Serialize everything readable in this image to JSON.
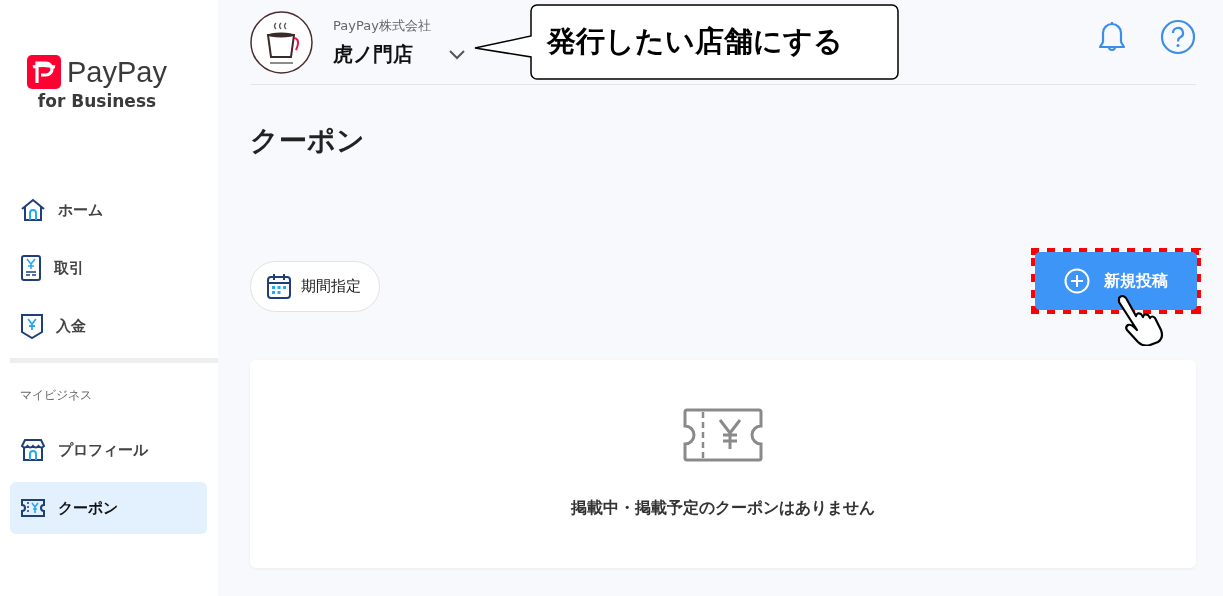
{
  "brand": {
    "name": "PayPay",
    "sub": "for Business"
  },
  "sidebar": {
    "items": [
      {
        "label": "ホーム",
        "kind": "home",
        "selected": false
      },
      {
        "label": "取引",
        "kind": "receipt",
        "selected": false
      },
      {
        "label": "入金",
        "kind": "deposit",
        "selected": false
      }
    ],
    "section": "マイビジネス",
    "section_items": [
      {
        "label": "プロフィール",
        "kind": "shop",
        "selected": false
      },
      {
        "label": "クーポン",
        "kind": "coupon",
        "selected": true
      }
    ]
  },
  "header": {
    "company": "PayPay株式会社",
    "store": "虎ノ門店"
  },
  "callout": "発行したい店舗にする",
  "page_title": "クーポン",
  "date_filter": "期間指定",
  "new_button": "新規投稿",
  "empty_message": "掲載中・掲載予定のクーポンはありません"
}
